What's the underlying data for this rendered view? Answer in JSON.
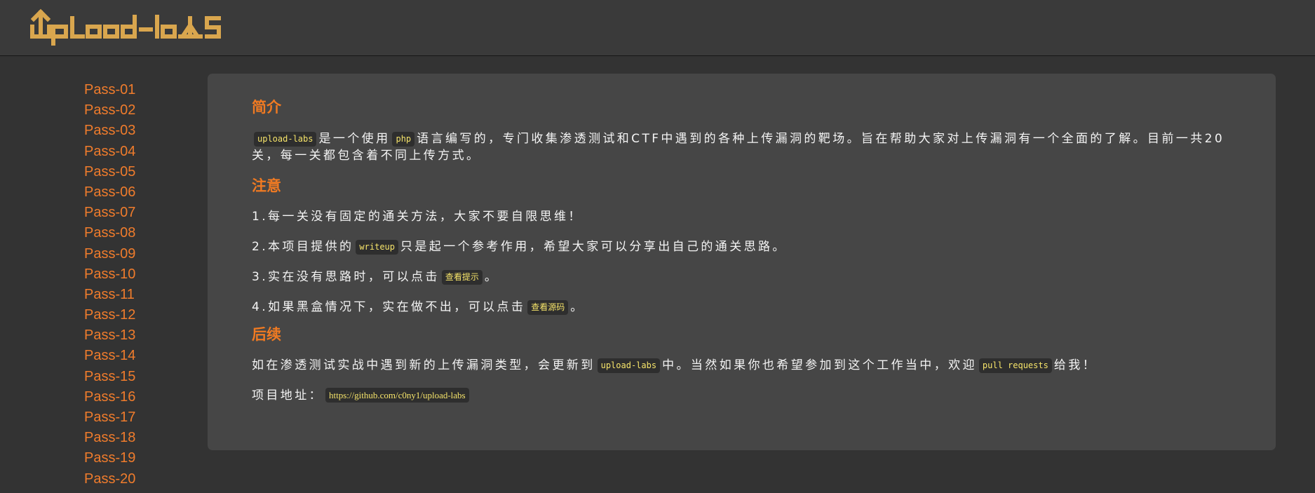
{
  "header": {
    "logo_text": "upload-labs"
  },
  "sidebar": {
    "items": [
      {
        "label": "Pass-01"
      },
      {
        "label": "Pass-02"
      },
      {
        "label": "Pass-03"
      },
      {
        "label": "Pass-04"
      },
      {
        "label": "Pass-05"
      },
      {
        "label": "Pass-06"
      },
      {
        "label": "Pass-07"
      },
      {
        "label": "Pass-08"
      },
      {
        "label": "Pass-09"
      },
      {
        "label": "Pass-10"
      },
      {
        "label": "Pass-11"
      },
      {
        "label": "Pass-12"
      },
      {
        "label": "Pass-13"
      },
      {
        "label": "Pass-14"
      },
      {
        "label": "Pass-15"
      },
      {
        "label": "Pass-16"
      },
      {
        "label": "Pass-17"
      },
      {
        "label": "Pass-18"
      },
      {
        "label": "Pass-19"
      },
      {
        "label": "Pass-20"
      }
    ]
  },
  "intro": {
    "heading": "简介",
    "code_name": "upload-labs",
    "text_a": "是一个使用",
    "code_php": "php",
    "text_b": "语言编写的，专门收集渗透测试和CTF中遇到的各种上传漏洞的靶场。旨在帮助大家对上传漏洞有一个全面的了解。目前一共20关，每一关都包含着不同上传方式。"
  },
  "notes": {
    "heading": "注意",
    "item1": "1.每一关没有固定的通关方法，大家不要自限思维！",
    "item2_a": "2.本项目提供的",
    "item2_code": "writeup",
    "item2_b": "只是起一个参考作用，希望大家可以分享出自己的通关思路。",
    "item3_a": "3.实在没有思路时，可以点击",
    "item3_link": "查看提示",
    "item3_b": "。",
    "item4_a": "4.如果黑盒情况下，实在做不出，可以点击",
    "item4_link": "查看源码",
    "item4_b": "。"
  },
  "followup": {
    "heading": "后续",
    "text_a": "如在渗透测试实战中遇到新的上传漏洞类型，会更新到",
    "code_name": "upload-labs",
    "text_b": "中。当然如果你也希望参加到这个工作当中，欢迎",
    "code_pr": "pull requests",
    "text_c": "给我！",
    "address_label": "项目地址：",
    "address_url": "https://github.com/c0ny1/upload-labs"
  },
  "colors": {
    "background": "#333333",
    "header_bg": "#3a3a3a",
    "panel_bg": "#464646",
    "accent_orange": "#f07a22",
    "logo_gold": "#d9a64e",
    "code_yellow": "#f6e46a"
  }
}
